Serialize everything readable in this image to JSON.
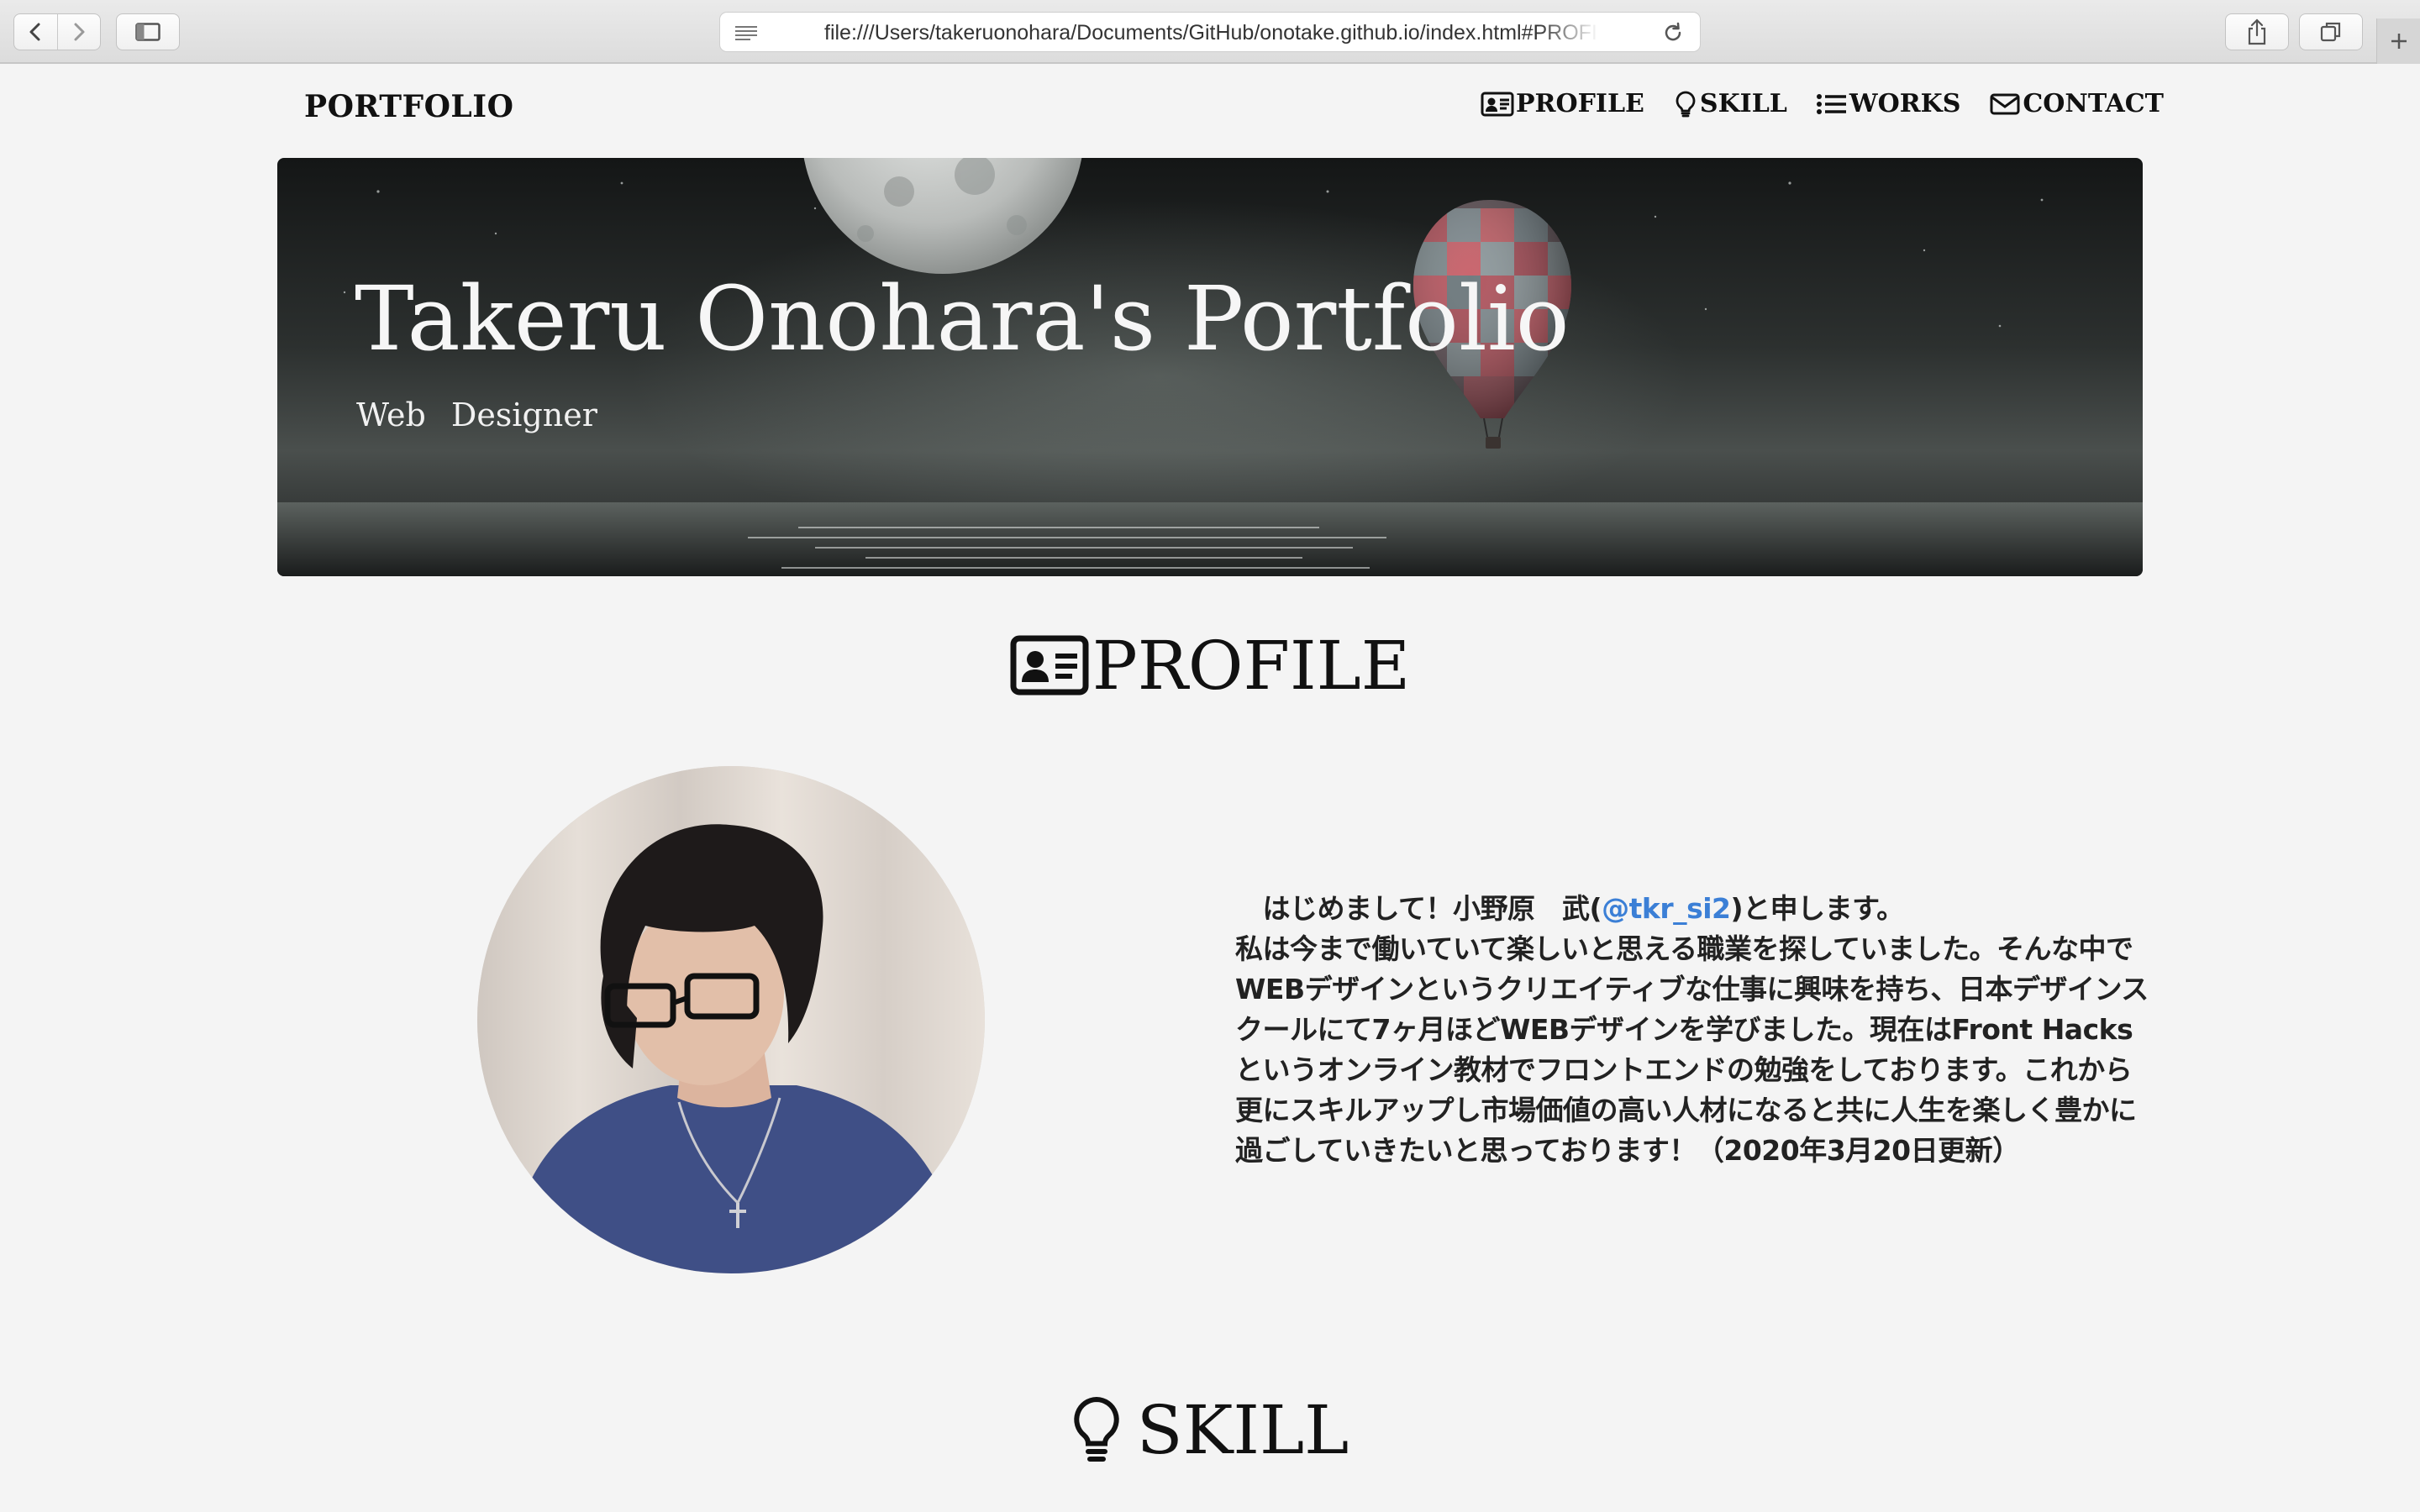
{
  "browser": {
    "url": "file:///Users/takeruonohara/Documents/GitHub/onotake.github.io/index.html#PROFILE"
  },
  "header": {
    "brand": "PORTFOLIO",
    "nav": [
      {
        "label": "PROFILE",
        "icon": "id-card-icon"
      },
      {
        "label": "SKILL",
        "icon": "lightbulb-icon"
      },
      {
        "label": "WORKS",
        "icon": "list-icon"
      },
      {
        "label": "CONTACT",
        "icon": "envelope-icon"
      }
    ]
  },
  "hero": {
    "title": "Takeru Onohara's Portfolio",
    "subtitle": "Web Designer"
  },
  "profile": {
    "heading": "PROFILE",
    "heading_icon": "id-card-icon",
    "intro_prefix": "　はじめまして！小野原　武(",
    "twitter_handle": "@tkr_si2",
    "intro_suffix": ")と申します。",
    "lines": [
      "私は今まで働いていて楽しいと思える職業を探していました。そんな中で",
      "WEBデザインというクリエイティブな仕事に興味を持ち、日本デザインス",
      "クールにて7ヶ月ほどWEBデザインを学びました。現在はFront Hacks",
      "というオンライン教材でフロントエンドの勉強をしております。これから",
      "更にスキルアップし市場価値の高い人材になると共に人生を楽しく豊かに",
      "過ごしていきたいと思っております！（2020年3月20日更新）"
    ],
    "link_color": "#3b7fd6"
  },
  "skill": {
    "heading": "SKILL",
    "heading_icon": "lightbulb-icon"
  }
}
